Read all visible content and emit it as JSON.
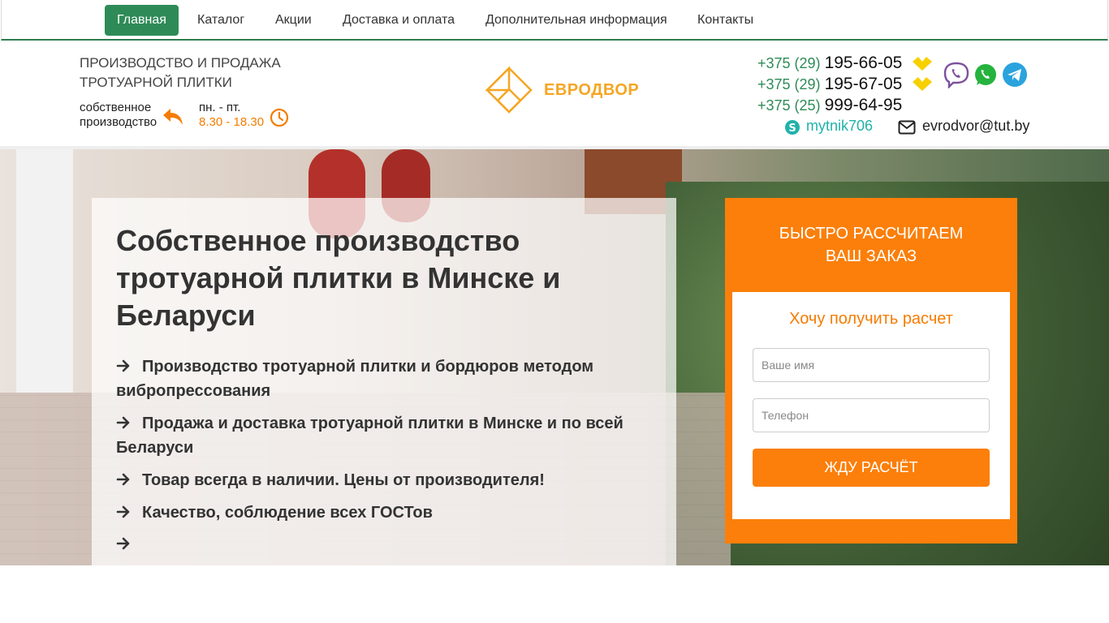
{
  "nav": {
    "items": [
      {
        "label": "Главная",
        "active": true
      },
      {
        "label": "Каталог"
      },
      {
        "label": "Акции"
      },
      {
        "label": "Доставка и оплата"
      },
      {
        "label": "Дополнительная информация"
      },
      {
        "label": "Контакты"
      }
    ]
  },
  "header": {
    "tagline_line1": "ПРОИЗВОДСТВО И ПРОДАЖА",
    "tagline_line2": "ТРОТУАРНОЙ ПЛИТКИ",
    "production_line1": "собственное",
    "production_line2": "производство",
    "hours_label": "пн. - пт.",
    "hours_value": "8.30 - 18.30",
    "logo_text": "ЕВРОДВОР",
    "phones": [
      {
        "code": "+375 (29)",
        "number": "195-66-05"
      },
      {
        "code": "+375 (29)",
        "number": "195-67-05"
      },
      {
        "code": "+375 (25)",
        "number": "999-64-95"
      }
    ],
    "skype": "mytnik706",
    "email": "evrodvor@tut.by",
    "icons": {
      "production": "reply-arrow-icon",
      "hours": "clock-icon",
      "carrier": "velcom-icon",
      "viber": "viber-icon",
      "whatsapp": "whatsapp-icon",
      "telegram": "telegram-icon",
      "skype": "skype-icon",
      "email": "envelope-icon"
    }
  },
  "hero": {
    "title": "Собственное производство тротуарной плитки в Минске и Беларуси",
    "bullets": [
      "Производство тротуарной плитки и бордюров методом вибропрессования",
      "Продажа и доставка тротуарной плитки в Минске и по всей Беларуси",
      "Товар всегда в наличии. Цены от производителя!",
      "Качество, соблюдение всех ГОСТов",
      ""
    ]
  },
  "form": {
    "heading_line1": "БЫСТРО РАССЧИТАЕМ",
    "heading_line2": "ВАШ ЗАКАЗ",
    "subheading": "Хочу получить расчет",
    "name_placeholder": "Ваше имя",
    "phone_placeholder": "Телефон",
    "submit_label": "ЖДУ РАСЧЁТ"
  },
  "colors": {
    "brand_green": "#2e8b57",
    "accent_orange": "#fb7f0a",
    "logo_gold": "#f5a623",
    "skype_teal": "#20b2aa"
  }
}
